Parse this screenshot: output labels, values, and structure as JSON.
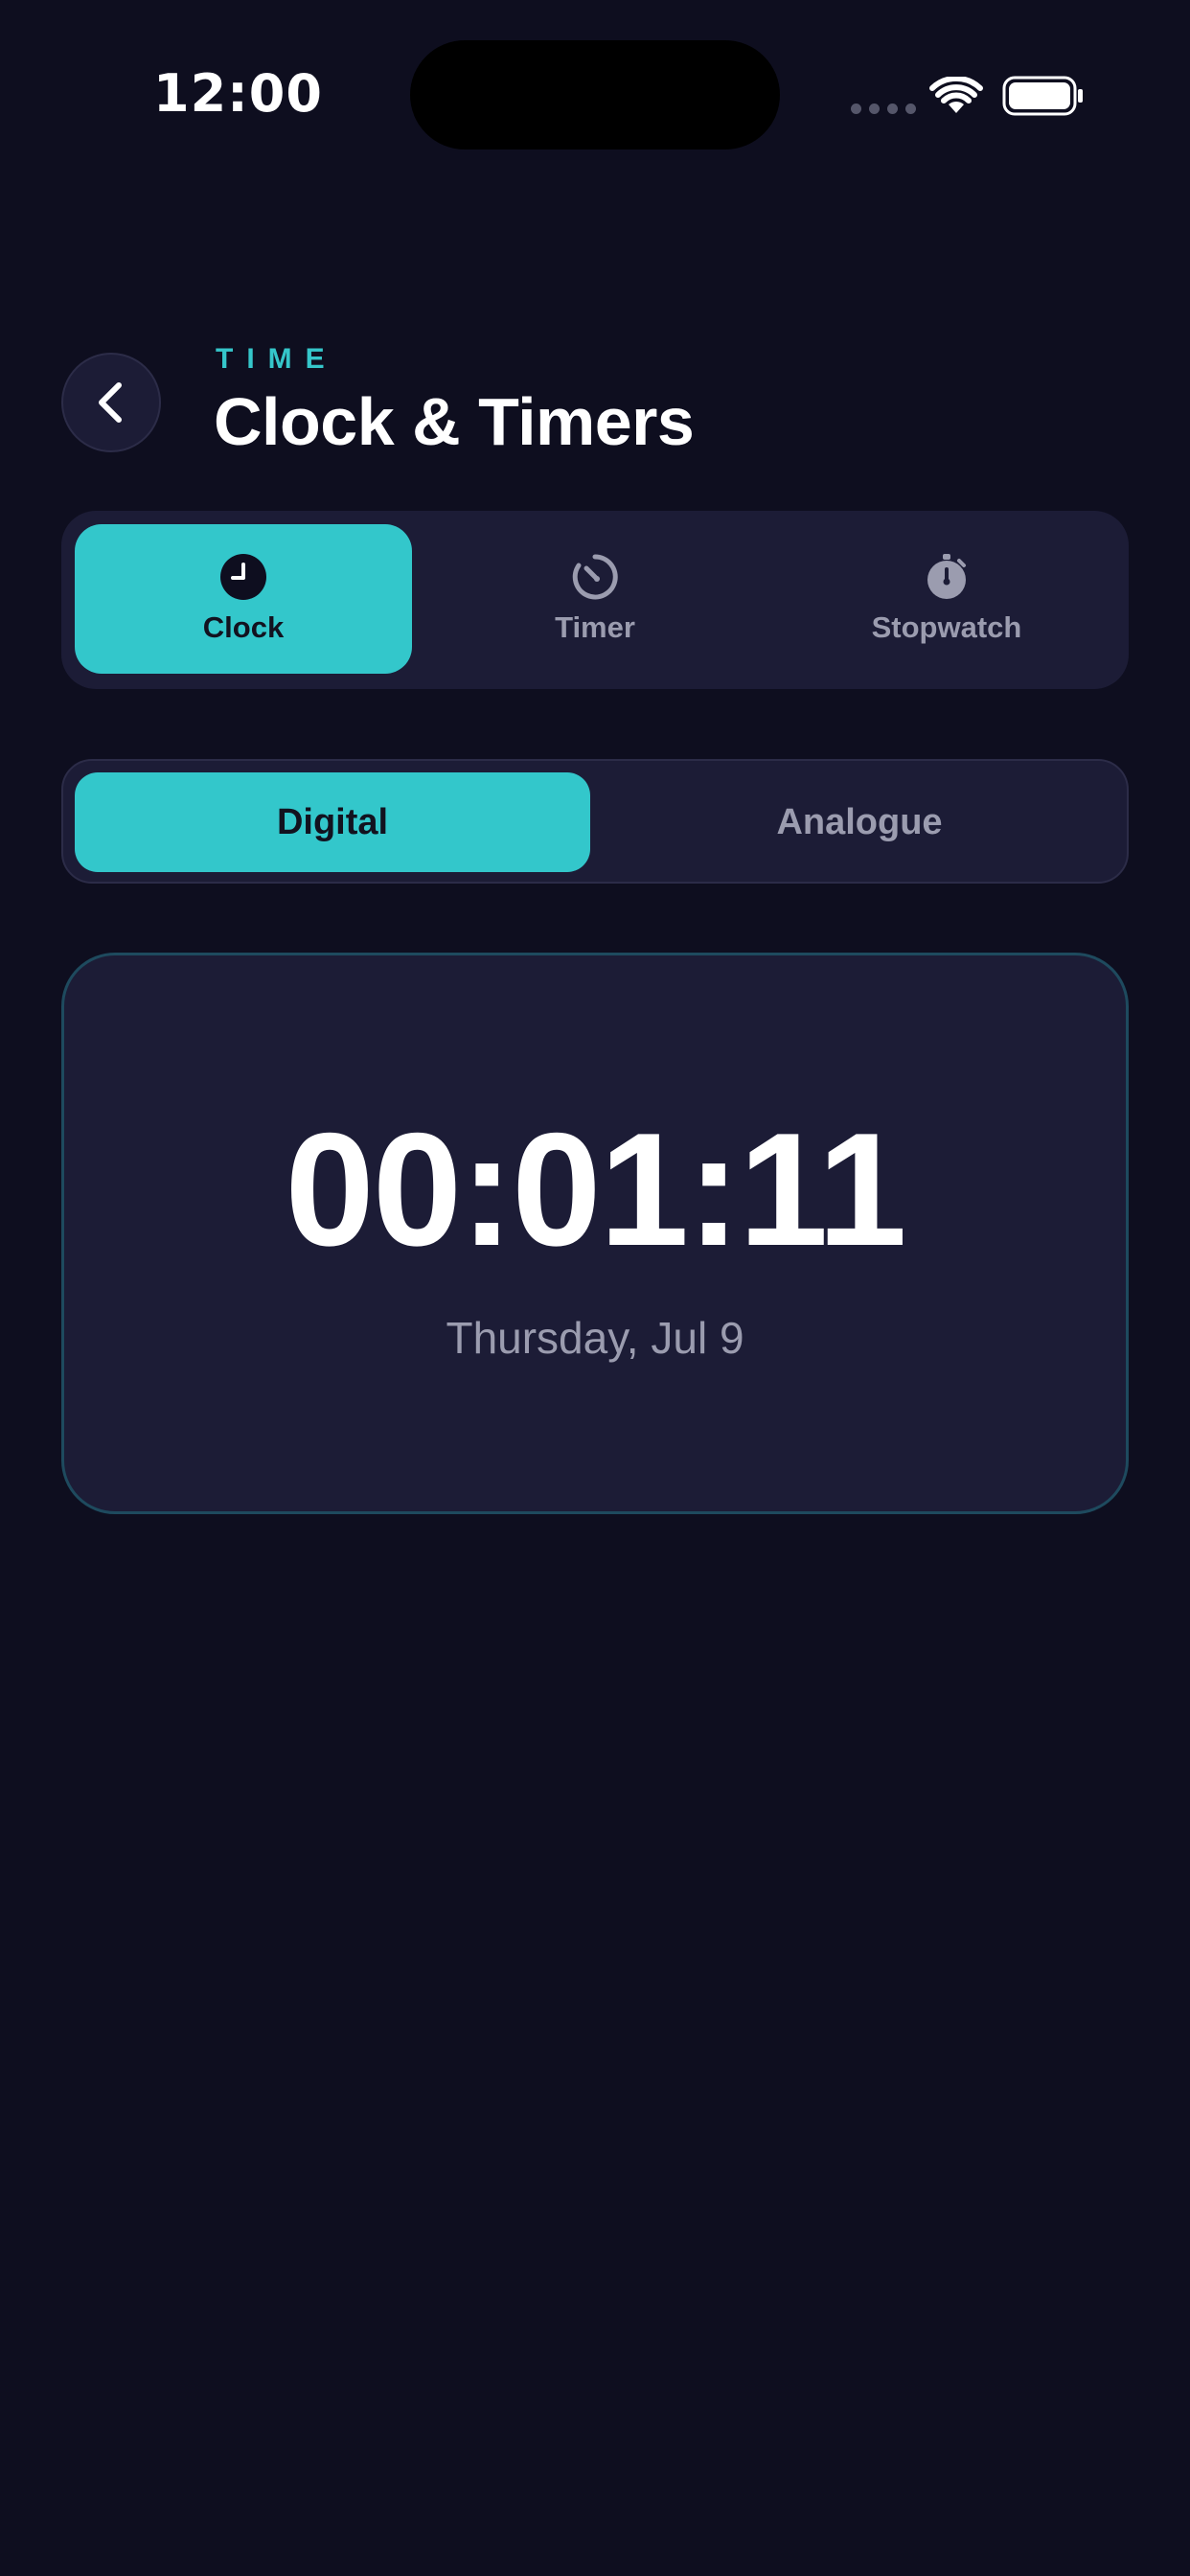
{
  "status_bar": {
    "time": "12:00"
  },
  "header": {
    "eyebrow": "TIME",
    "title": "Clock & Timers"
  },
  "mode_tabs": [
    {
      "label": "Clock",
      "icon": "clock-icon",
      "selected": true
    },
    {
      "label": "Timer",
      "icon": "timer-icon",
      "selected": false
    },
    {
      "label": "Stopwatch",
      "icon": "stopwatch-icon",
      "selected": false
    }
  ],
  "view_toggle": {
    "options": [
      "Digital",
      "Analogue"
    ],
    "selected": "Digital"
  },
  "clock": {
    "time": "00:01:11",
    "date": "Thursday, Jul 9"
  },
  "colors": {
    "background": "#0e0e1f",
    "surface": "#1c1c36",
    "accent": "#33c7cb",
    "muted_text": "#9b9caf",
    "card_border": "#1e4a5e"
  }
}
